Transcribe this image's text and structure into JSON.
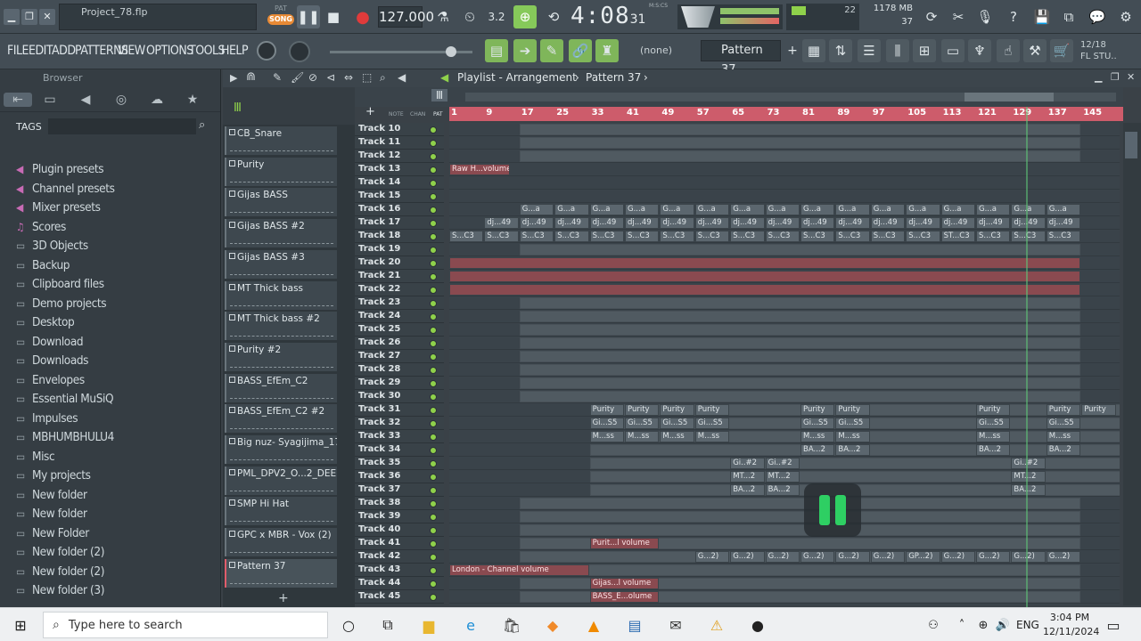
{
  "window": {
    "title": "Project_78.flp"
  },
  "transport": {
    "mode": "SONG",
    "mode_top": "PAT",
    "tempo": "127.000",
    "time": "4:08",
    "time_small": "31",
    "time_label": "M:S:CS",
    "cpu": "22",
    "memory": "1178 MB",
    "voices": "37"
  },
  "menu": [
    "FILE",
    "EDIT",
    "ADD",
    "PATTERNS",
    "VIEW",
    "OPTIONS",
    "TOOLS",
    "HELP"
  ],
  "toolbar": {
    "channel_select": "(none)",
    "pattern_select": "Pattern 37",
    "hint_top": "12/18",
    "hint_bottom": "FL STU.."
  },
  "browser": {
    "title": "Browser",
    "tags_label": "TAGS",
    "items": [
      {
        "label": "Plugin presets",
        "type": "preset"
      },
      {
        "label": "Channel presets",
        "type": "preset"
      },
      {
        "label": "Mixer presets",
        "type": "preset"
      },
      {
        "label": "Scores",
        "type": "score"
      },
      {
        "label": "3D Objects",
        "type": "folder"
      },
      {
        "label": "Backup",
        "type": "folder"
      },
      {
        "label": "Clipboard files",
        "type": "folder"
      },
      {
        "label": "Demo projects",
        "type": "folder"
      },
      {
        "label": "Desktop",
        "type": "folder"
      },
      {
        "label": "Download",
        "type": "folder"
      },
      {
        "label": "Downloads",
        "type": "folder"
      },
      {
        "label": "Envelopes",
        "type": "folder"
      },
      {
        "label": "Essential MuSiQ",
        "type": "folder"
      },
      {
        "label": "Impulses",
        "type": "folder"
      },
      {
        "label": "MBHUMBHULU4",
        "type": "folder"
      },
      {
        "label": "Misc",
        "type": "folder"
      },
      {
        "label": "My projects",
        "type": "folder"
      },
      {
        "label": "New folder",
        "type": "folder"
      },
      {
        "label": "New folder",
        "type": "folder"
      },
      {
        "label": "New Folder",
        "type": "folder"
      },
      {
        "label": "New folder (2)",
        "type": "folder"
      },
      {
        "label": "New folder (2)",
        "type": "folder"
      },
      {
        "label": "New folder (3)",
        "type": "folder"
      }
    ]
  },
  "picker": {
    "patterns": [
      "CB_Snare",
      "Purity",
      "Gijas BASS",
      "Gijas BASS #2",
      "Gijas BASS #3",
      "MT Thick bass",
      "MT Thick bass #2",
      "Purity #2",
      "BASS_EfEm_C2",
      "BASS_EfEm_C2 #2",
      "Big nuz- Syagijima_17",
      "PML_DPV2_O...2_DEEP_11",
      "SMP Hi Hat",
      "GPC x MBR - Vox (2)",
      "Pattern 37"
    ],
    "add": "+"
  },
  "playlist": {
    "title": "Playlist - Arrangement",
    "breadcrumb": "Pattern 37",
    "ruler": [
      "1",
      "9",
      "17",
      "25",
      "33",
      "41",
      "49",
      "57",
      "65",
      "73",
      "81",
      "89",
      "97",
      "105",
      "113",
      "121",
      "129",
      "137",
      "145"
    ],
    "head_labels": [
      "NOTE",
      "CHAN",
      "PAT"
    ]
  },
  "tracks": [
    "Track 10",
    "Track 11",
    "Track 12",
    "Track 13",
    "Track 14",
    "Track 15",
    "Track 16",
    "Track 17",
    "Track 18",
    "Track 19",
    "Track 20",
    "Track 21",
    "Track 22",
    "Track 23",
    "Track 24",
    "Track 25",
    "Track 26",
    "Track 27",
    "Track 28",
    "Track 29",
    "Track 30",
    "Track 31",
    "Track 32",
    "Track 33",
    "Track 34",
    "Track 35",
    "Track 36",
    "Track 37",
    "Track 38",
    "Track 39",
    "Track 40",
    "Track 41",
    "Track 42",
    "Track 43",
    "Track 44",
    "Track 45"
  ],
  "clips": {
    "raw": "Raw H...volume",
    "purity": "Purity",
    "gi_s5": "Gi...S5",
    "m_ss": "M...ss",
    "ba_2": "BA...2",
    "gi2": "Gi..#2",
    "mt2": "MT...2",
    "purit_vol": "Purit...l volume",
    "g2": "G...2)",
    "gp2": "GP...2)",
    "london": "London - Channel volume",
    "gijas_vol": "Gijas...l volume",
    "bass_e": "BASS_E...olume",
    "g_a": "G...a",
    "dj49": "dj...49",
    "s_c3": "S...C3",
    "st_c3": "ST...C3"
  },
  "taskbar": {
    "search_placeholder": "Type here to search",
    "time": "3:04 PM",
    "date": "12/11/2024",
    "lang": "ENG"
  }
}
